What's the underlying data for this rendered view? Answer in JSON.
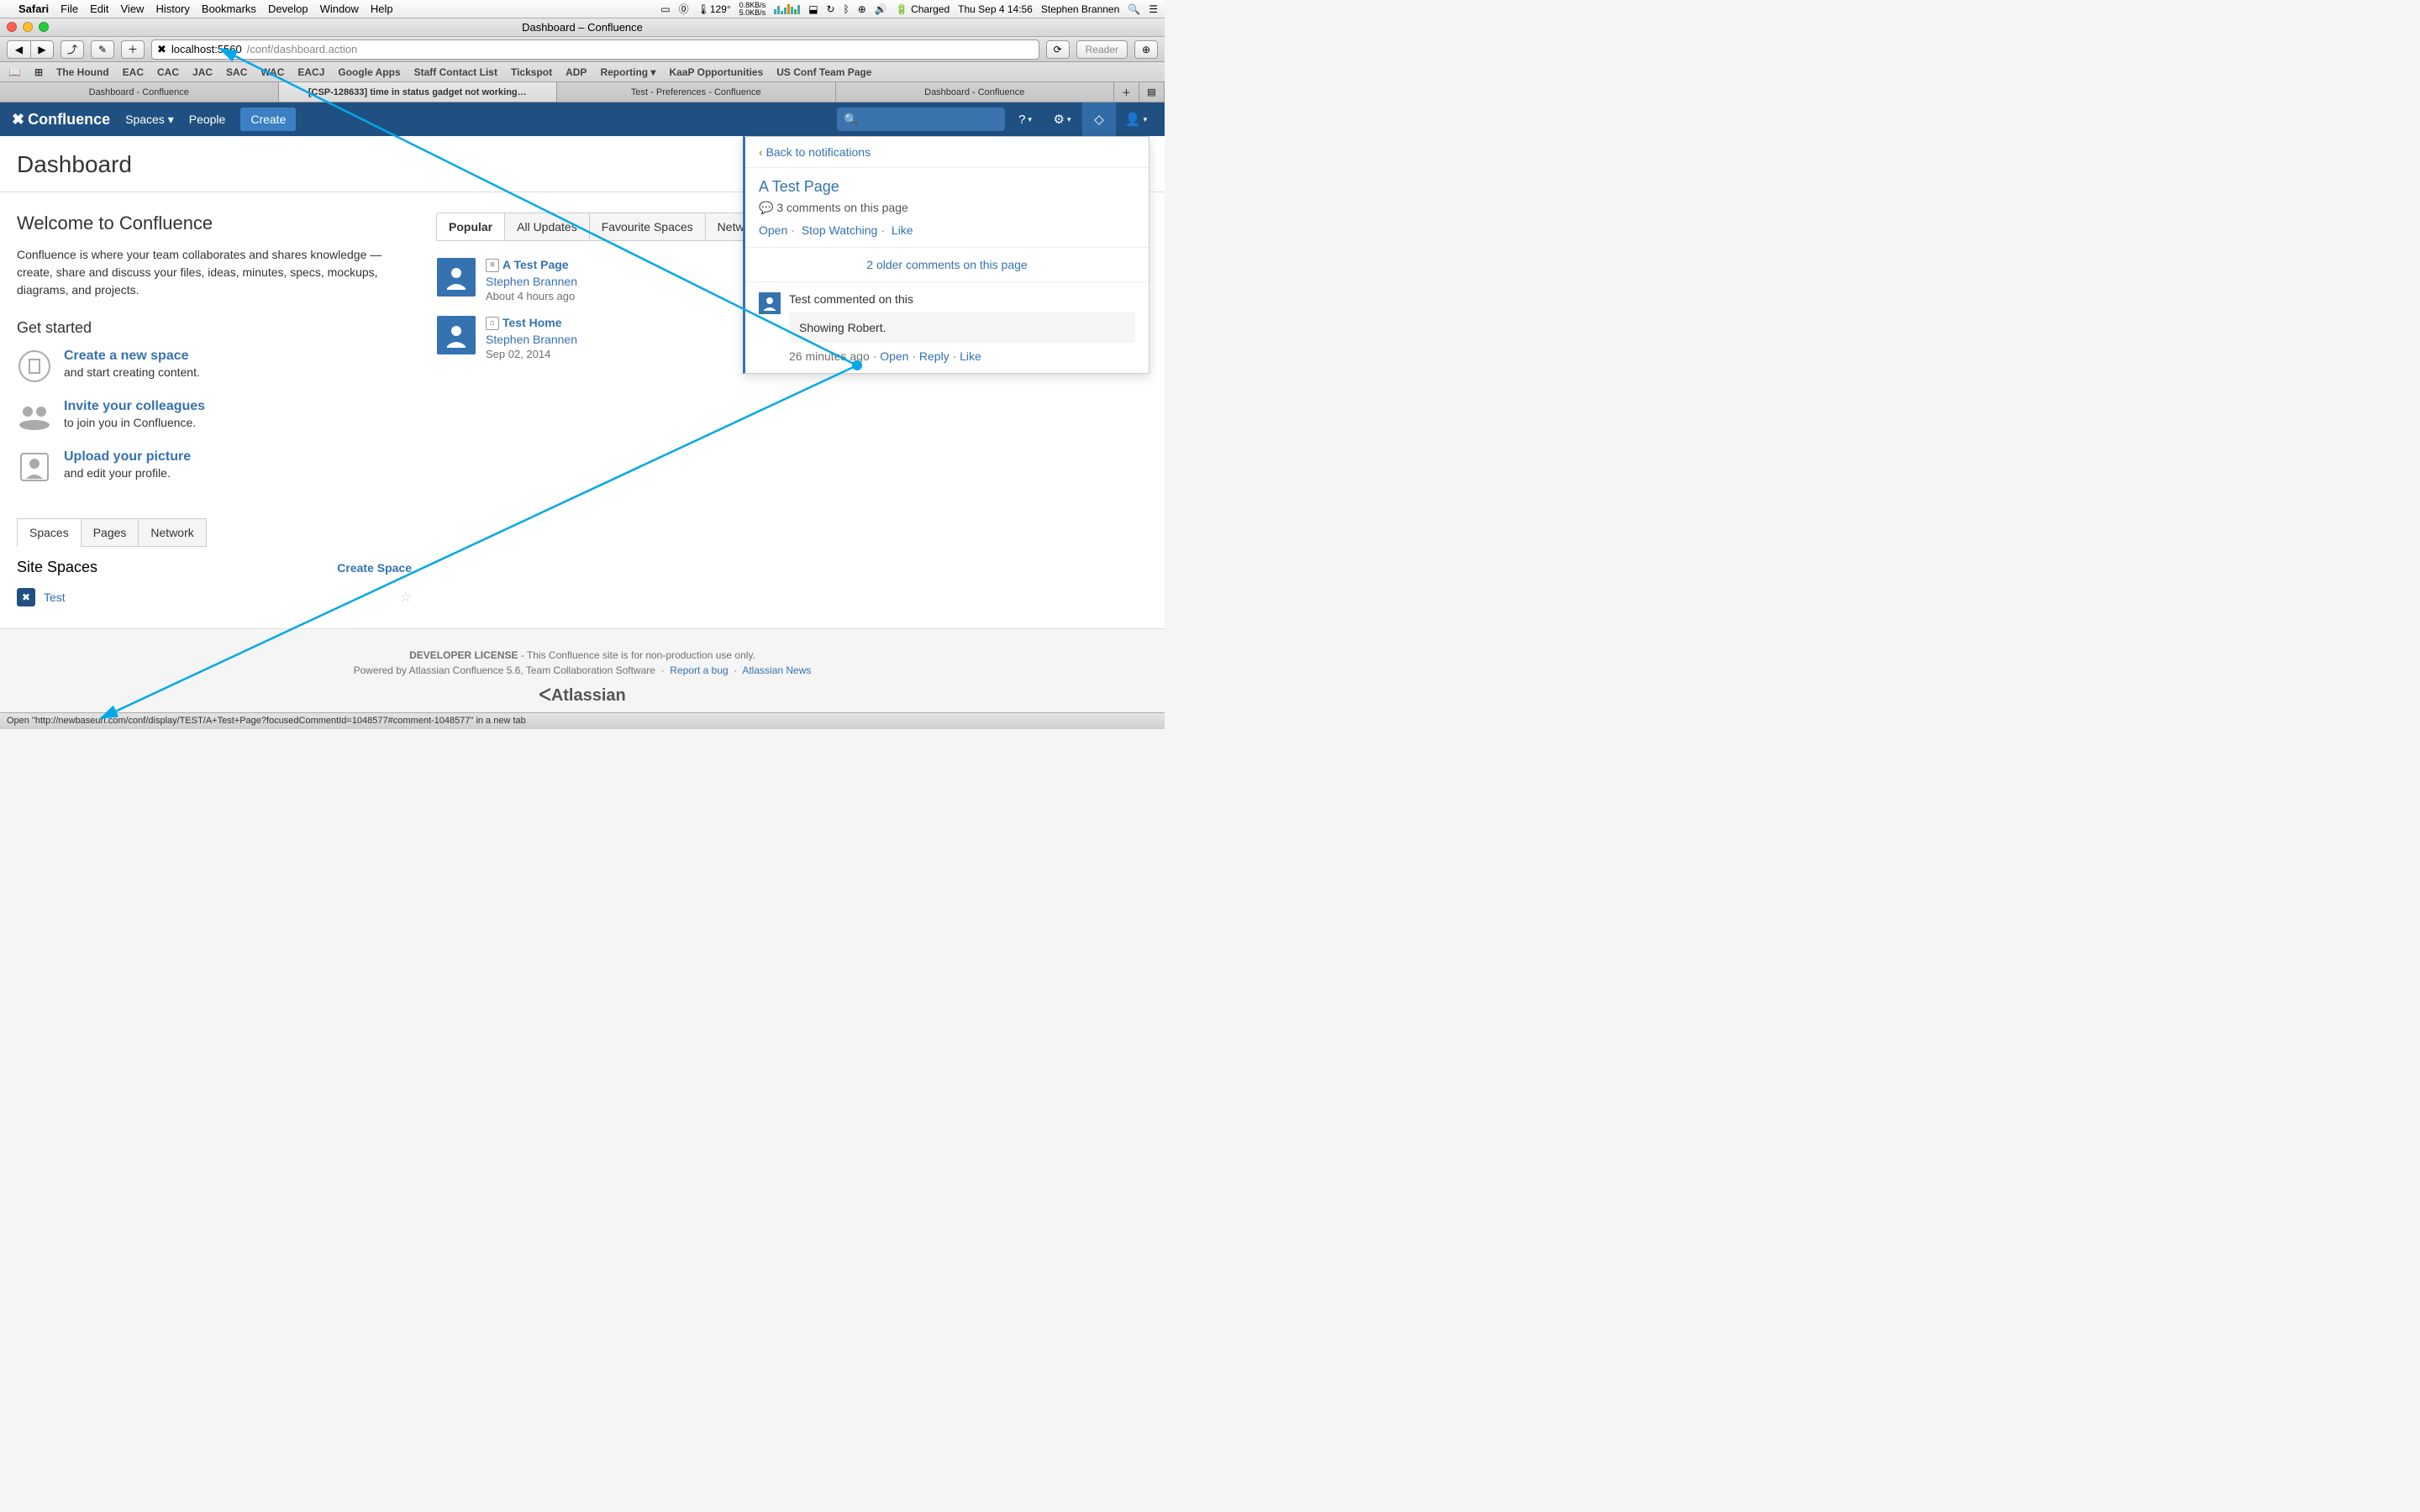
{
  "menubar": {
    "app": "Safari",
    "items": [
      "File",
      "Edit",
      "View",
      "History",
      "Bookmarks",
      "Develop",
      "Window",
      "Help"
    ],
    "temp": "129°",
    "net1": "0.8KB/s",
    "net2": "5.0KB/s",
    "battery": "Charged",
    "datetime": "Thu Sep 4 14:56",
    "user": "Stephen Brannen"
  },
  "window": {
    "title": "Dashboard – Confluence"
  },
  "url": {
    "host": "localhost:5560",
    "path": "/conf/dashboard.action"
  },
  "reader": "Reader",
  "bookmarks": [
    "The Hound",
    "EAC",
    "CAC",
    "JAC",
    "SAC",
    "WAC",
    "EACJ",
    "Google Apps",
    "Staff Contact List",
    "Tickspot",
    "ADP",
    "Reporting ▾",
    "KaaP Opportunities",
    "US Conf Team Page"
  ],
  "tabs": [
    {
      "label": "Dashboard - Confluence",
      "active": false
    },
    {
      "label": "[CSP-128633] time in status gadget not working…",
      "active": true
    },
    {
      "label": "Test - Preferences - Confluence",
      "active": false
    },
    {
      "label": "Dashboard - Confluence",
      "active": false
    }
  ],
  "conf": {
    "logo": "Confluence",
    "nav": {
      "spaces": "Spaces ▾",
      "people": "People",
      "create": "Create"
    }
  },
  "dashboard": {
    "title": "Dashboard"
  },
  "welcome": {
    "heading": "Welcome to Confluence",
    "body": "Confluence is where your team collaborates and shares knowledge — create, share and discuss your files, ideas, minutes, specs, mockups, diagrams, and projects.",
    "get_started": "Get started",
    "items": [
      {
        "link": "Create a new space",
        "sub": "and start creating content."
      },
      {
        "link": "Invite your colleagues",
        "sub": "to join you in Confluence."
      },
      {
        "link": "Upload your picture",
        "sub": "and edit your profile."
      }
    ]
  },
  "feed": {
    "tabs": [
      "Popular",
      "All Updates",
      "Favourite Spaces",
      "Network"
    ],
    "items": [
      {
        "icon": "≡",
        "title": "A Test Page",
        "author": "Stephen Brannen",
        "time": "About 4 hours ago"
      },
      {
        "icon": "⌂",
        "title": "Test Home",
        "author": "Stephen Brannen",
        "time": "Sep 02, 2014"
      }
    ]
  },
  "lower": {
    "tabs": [
      "Spaces",
      "Pages",
      "Network"
    ],
    "heading": "Site Spaces",
    "create": "Create Space",
    "spaces": [
      {
        "name": "Test"
      }
    ]
  },
  "notif": {
    "back": "Back to notifications",
    "title": "A Test Page",
    "meta": "3 comments on this page",
    "actions": [
      "Open",
      "Stop Watching",
      "Like"
    ],
    "older": "2 older comments on this page",
    "comment": {
      "who": "Test commented on this",
      "text": "Showing Robert.",
      "time": "26 minutes ago",
      "actions": [
        "Open",
        "Reply",
        "Like"
      ]
    }
  },
  "footer": {
    "license_b": "DEVELOPER LICENSE",
    "license": " - This Confluence site is for non-production use only.",
    "powered": "Powered by Atlassian Confluence 5.6, Team Collaboration Software",
    "report": "Report a bug",
    "news": "Atlassian News",
    "brand": "ᐸAtlassian"
  },
  "status": "Open \"http://newbaseurl.com/conf/display/TEST/A+Test+Page?focusedCommentId=1048577#comment-1048577\" in a new tab"
}
